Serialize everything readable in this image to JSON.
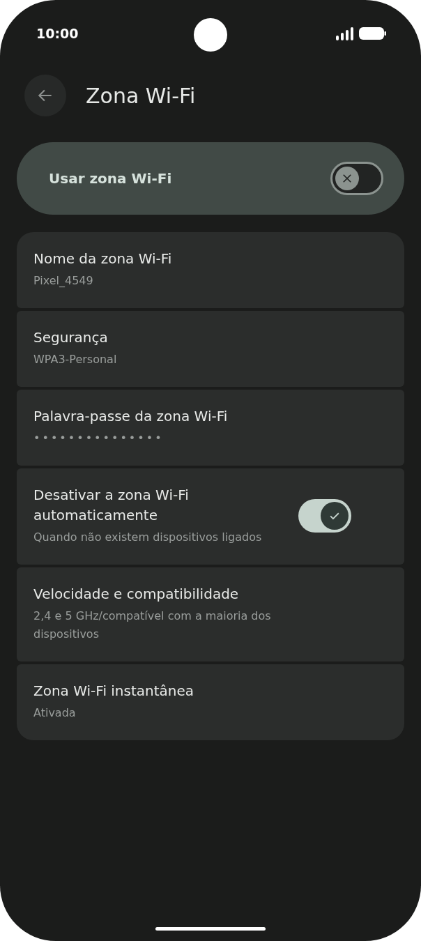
{
  "status_bar": {
    "time": "10:00"
  },
  "header": {
    "title": "Zona Wi-Fi"
  },
  "main_switch": {
    "label": "Usar zona Wi-Fi",
    "on": false
  },
  "settings": [
    {
      "kind": "text",
      "title": "Nome da zona Wi-Fi",
      "summary": "Pixel_4549"
    },
    {
      "kind": "text",
      "title": "Segurança",
      "summary": "WPA3-Personal"
    },
    {
      "kind": "password",
      "title": "Palavra-passe da zona Wi-Fi",
      "summary": "•••••••••••••••"
    },
    {
      "kind": "toggle",
      "title": "Desativar a zona Wi-Fi automaticamente",
      "summary": "Quando não existem dispositivos ligados",
      "on": true
    },
    {
      "kind": "text",
      "title": "Velocidade e compatibilidade",
      "summary": "2,4 e 5 GHz/compatível com a maioria dos dispositivos"
    },
    {
      "kind": "text",
      "title": "Zona Wi-Fi instantânea",
      "summary": "Ativada"
    }
  ]
}
